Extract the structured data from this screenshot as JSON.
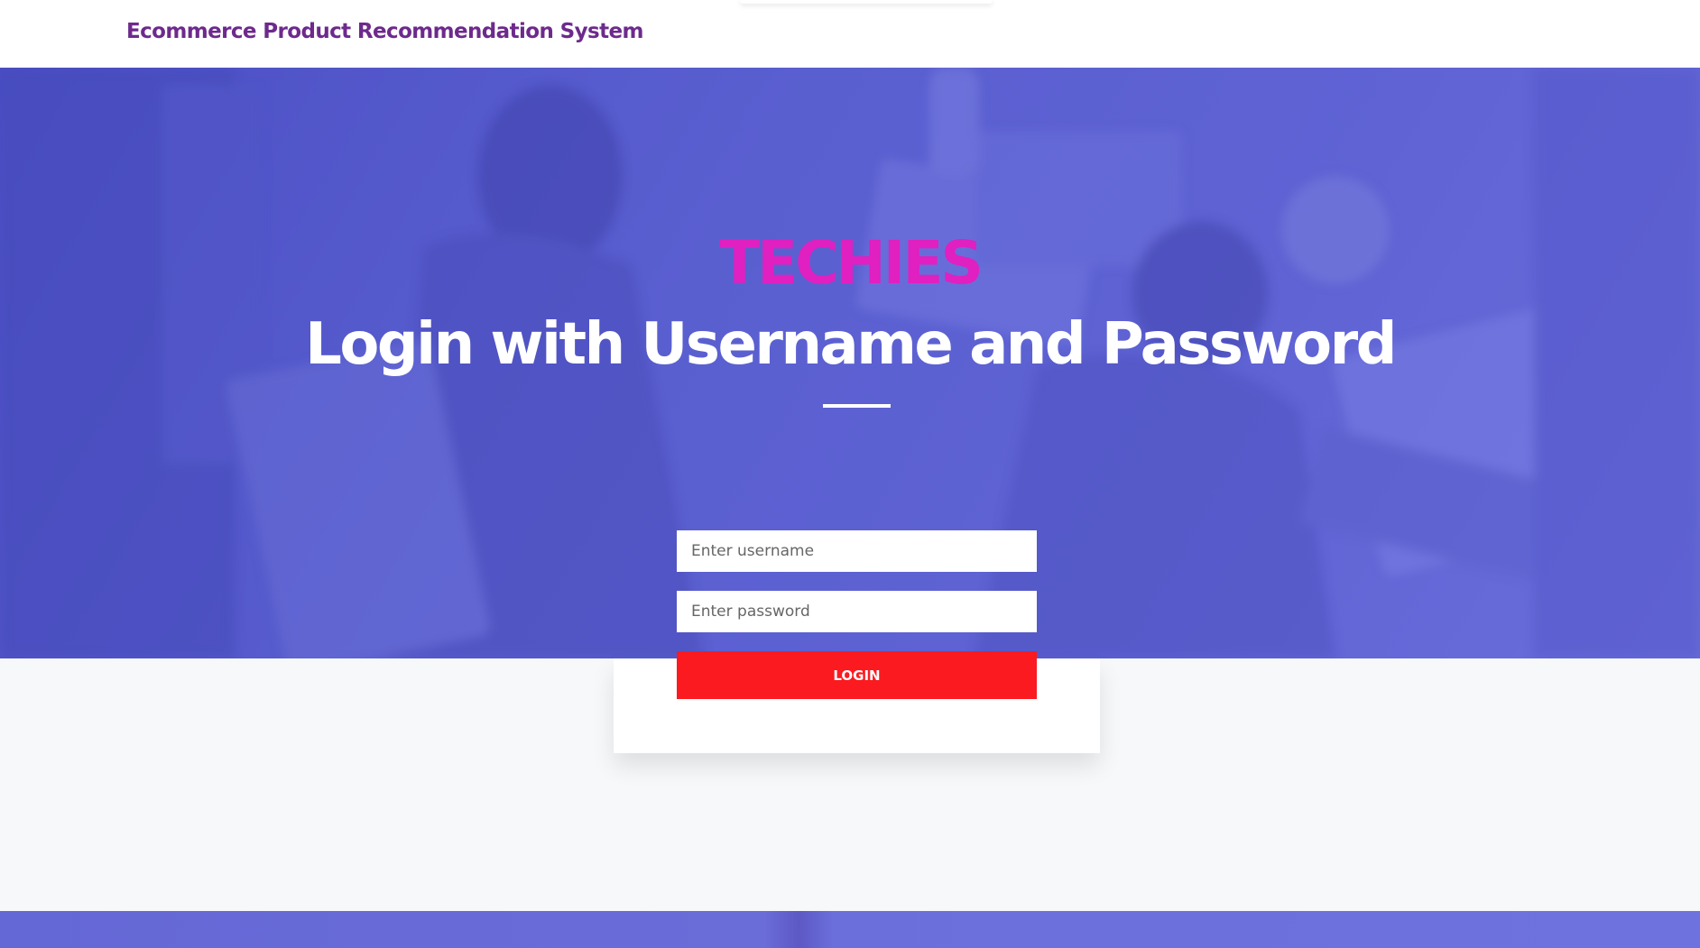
{
  "header": {
    "brand": "Ecommerce Product Recommendation System"
  },
  "hero": {
    "brand_heading": "TECHIES",
    "title": "Login with Username and Password"
  },
  "login_form": {
    "username_placeholder": "Enter username",
    "password_placeholder": "Enter password",
    "submit_label": "LOGIN"
  },
  "colors": {
    "brand_text": "#6d2a8c",
    "accent_pink": "#e020c0",
    "hero_overlay": "#5a5fd0",
    "login_button": "#fb1a1f"
  }
}
